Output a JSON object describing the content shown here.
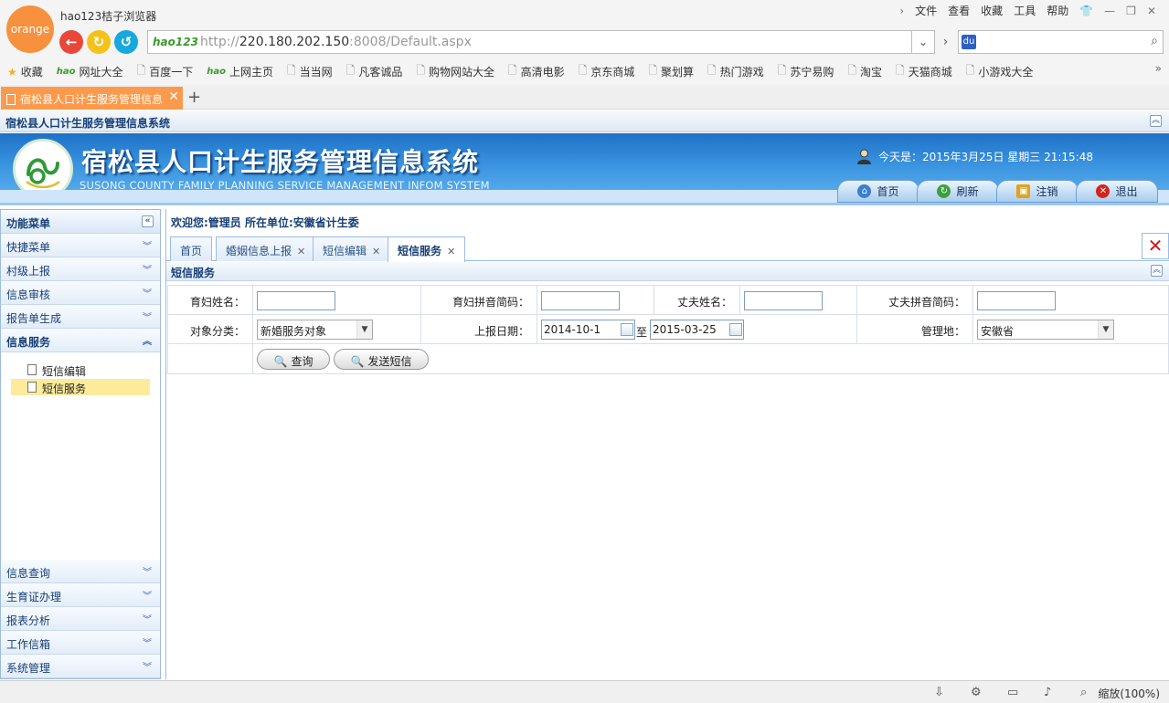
{
  "browser": {
    "logo_text": "orange",
    "title": "hao123桔子浏览器",
    "menu": [
      "文件",
      "查看",
      "收藏",
      "工具",
      "帮助"
    ],
    "address_logo": "hao123",
    "url_prefix": "http://",
    "url_host": "220.180.202.150",
    "url_rest": ":8008/Default.aspx",
    "bookmarks": [
      {
        "label": "收藏",
        "icon": "star-icon"
      },
      {
        "label": "网址大全",
        "icon": "hao-icon"
      },
      {
        "label": "百度一下",
        "icon": "page-icon"
      },
      {
        "label": "上网主页",
        "icon": "hao-icon"
      },
      {
        "label": "当当网",
        "icon": "page-icon"
      },
      {
        "label": "凡客诚品",
        "icon": "page-icon"
      },
      {
        "label": "购物网站大全",
        "icon": "page-icon"
      },
      {
        "label": "高清电影",
        "icon": "page-icon"
      },
      {
        "label": "京东商城",
        "icon": "page-icon"
      },
      {
        "label": "聚划算",
        "icon": "page-icon"
      },
      {
        "label": "热门游戏",
        "icon": "page-icon"
      },
      {
        "label": "苏宁易购",
        "icon": "page-icon"
      },
      {
        "label": "淘宝",
        "icon": "page-icon"
      },
      {
        "label": "天猫商城",
        "icon": "page-icon"
      },
      {
        "label": "小游戏大全",
        "icon": "page-icon"
      }
    ],
    "tab_title": "宿松县人口计生服务管理信息",
    "zoom_label": "缩放(100%)"
  },
  "app": {
    "system_bar_title": "宿松县人口计生服务管理信息系统",
    "banner_title": "宿松县人口计生服务管理信息系统",
    "banner_subtitle": "SUSONG COUNTY FAMILY PLANNING SERVICE MANAGEMENT INFOM SYSTEM",
    "today_label": "今天是：2015年3月25日 星期三 21:15:48",
    "top_nav": [
      {
        "label": "首页",
        "icon": "home-icon"
      },
      {
        "label": "刷新",
        "icon": "refresh-icon"
      },
      {
        "label": "注销",
        "icon": "lock-icon"
      },
      {
        "label": "退出",
        "icon": "exit-icon"
      }
    ]
  },
  "sidebar": {
    "header": "功能菜单",
    "items_top": [
      "快捷菜单",
      "村级上报",
      "信息审核",
      "报告单生成",
      "信息服务"
    ],
    "sub_items": [
      "短信编辑",
      "短信服务"
    ],
    "items_bottom": [
      "信息查询",
      "生育证办理",
      "报表分析",
      "工作信箱",
      "系统管理"
    ]
  },
  "main": {
    "welcome": "欢迎您:管理员 所在单位:安徽省计生委",
    "tabs": [
      "首页",
      "婚姻信息上报",
      "短信编辑",
      "短信服务"
    ],
    "panel_title": "短信服务",
    "form": {
      "wife_name_label": "育妇姓名：",
      "wife_pinyin_label": "育妇拼音简码：",
      "husband_name_label": "丈夫姓名：",
      "husband_pinyin_label": "丈夫拼音简码：",
      "category_label": "对象分类：",
      "category_value": "新婚服务对象",
      "report_date_label": "上报日期：",
      "date_from": "2014-10-1",
      "date_sep": "至",
      "date_to": "2015-03-25",
      "manage_label": "管理地：",
      "manage_value": "安徽省",
      "query_button": "查询",
      "send_button": "发送短信"
    }
  },
  "colors": {
    "browser_accent": "#f7913d",
    "tab_orange": "#fb9a4c",
    "banner_blue": "#1e71c6",
    "nav_text": "#173f77",
    "highlight": "#fbeb9a"
  }
}
